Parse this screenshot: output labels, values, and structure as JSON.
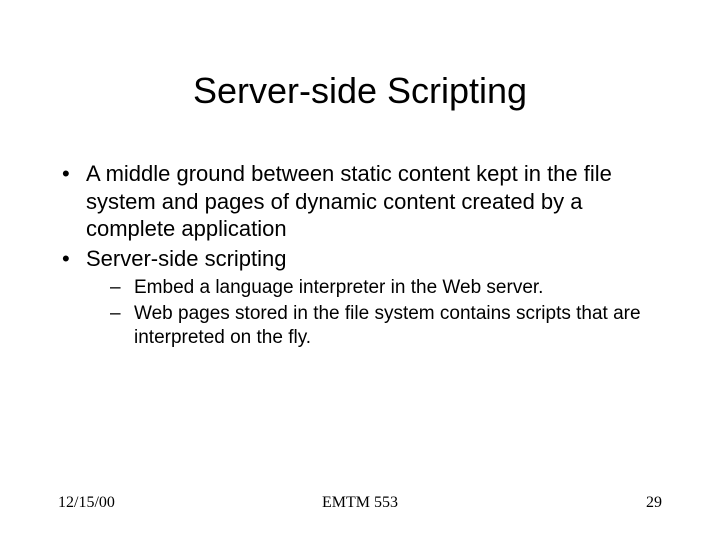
{
  "title": "Server-side Scripting",
  "bullets": [
    {
      "text": "A middle ground between static content kept in the file system and pages of dynamic content created by a complete application"
    },
    {
      "text": "Server-side scripting",
      "sub": [
        "Embed a language interpreter in the Web server.",
        "Web pages stored in the file system contains scripts that are interpreted on the fly."
      ]
    }
  ],
  "footer": {
    "date": "12/15/00",
    "center": "EMTM 553",
    "page": "29"
  }
}
